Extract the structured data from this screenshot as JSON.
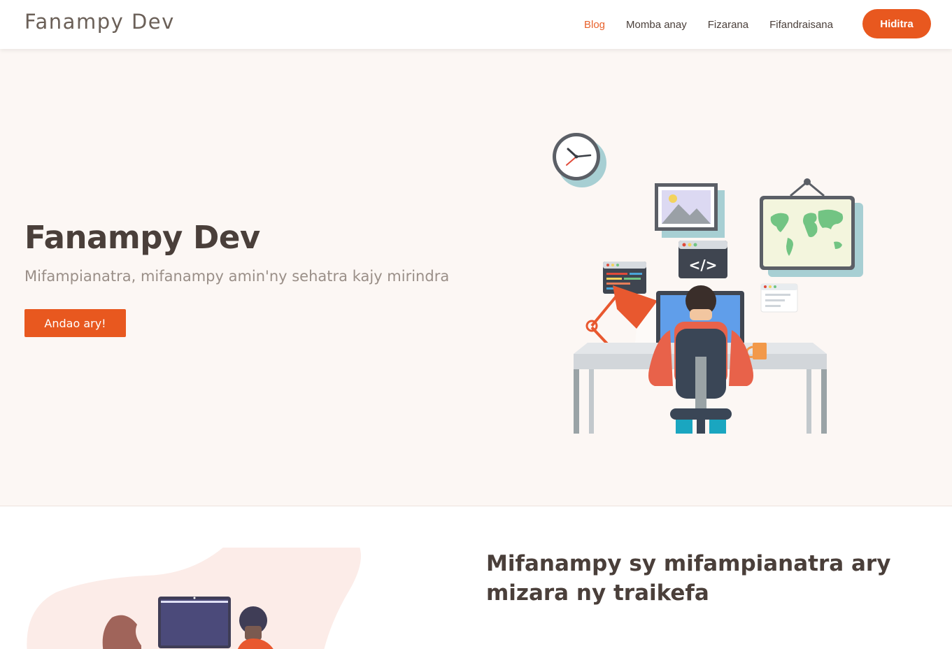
{
  "nav": {
    "brand": "Fanampy Dev",
    "links": [
      {
        "label": "Blog",
        "active": true
      },
      {
        "label": "Momba anay",
        "active": false
      },
      {
        "label": "Fizarana",
        "active": false
      },
      {
        "label": "Fifandraisana",
        "active": false
      }
    ],
    "login_label": "Hiditra"
  },
  "hero": {
    "title": "Fanampy Dev",
    "subtitle": "Mifampianatra, mifanampy amin'ny sehatra kajy mirindra",
    "cta_label": "Andao ary!",
    "code_tag": "</>"
  },
  "section2": {
    "title": "Mifanampy sy mifampianatra ary mizara ny traikefa"
  },
  "colors": {
    "accent": "#e8581f",
    "text_dark": "#4a3f3a",
    "text_muted": "#9a8f88",
    "hero_bg": "#fcf7f4"
  }
}
